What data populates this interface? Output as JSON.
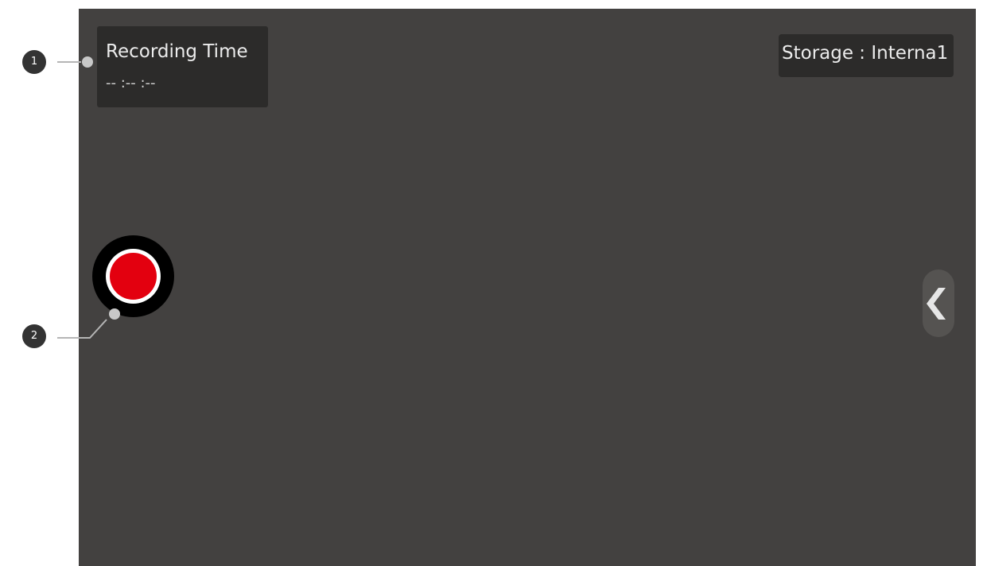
{
  "recording": {
    "title": "Recording Time",
    "value": "-- :-- :--"
  },
  "storage": {
    "label": "Storage : Interna1"
  },
  "callouts": [
    {
      "number": "1"
    },
    {
      "number": "2"
    }
  ],
  "colors": {
    "screen_bg": "#434140",
    "panel_bg": "#2c2b2a",
    "record_red": "#e3000f"
  },
  "icons": {
    "record": "record-icon",
    "side_handle": "chevron-left-icon"
  }
}
